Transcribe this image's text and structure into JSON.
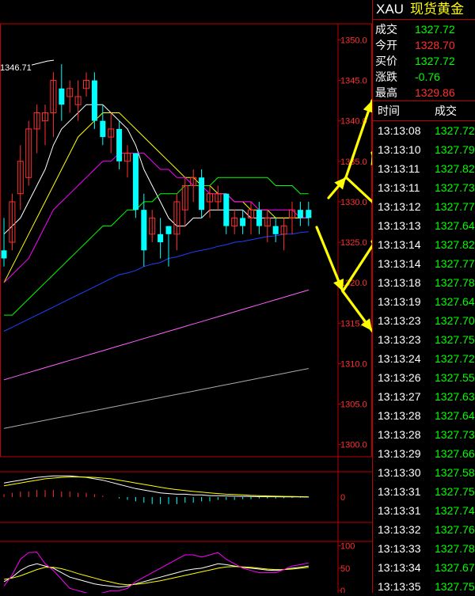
{
  "header": {
    "symbol": "XAU",
    "name": "现货黄金"
  },
  "quote": [
    {
      "label": "成交",
      "value": "1327.72",
      "color": "green"
    },
    {
      "label": "今开",
      "value": "1328.70",
      "color": "red"
    },
    {
      "label": "买价",
      "value": "1327.72",
      "color": "green"
    },
    {
      "label": "涨跌",
      "value": "-0.76",
      "color": "green"
    },
    {
      "label": "最高",
      "value": "1329.86",
      "color": "red"
    }
  ],
  "ticks_header": {
    "time": "时间",
    "price": "成交"
  },
  "ticks": [
    {
      "time": "13:13:08",
      "price": "1327.72"
    },
    {
      "time": "13:13:10",
      "price": "1327.79"
    },
    {
      "time": "13:13:11",
      "price": "1327.82"
    },
    {
      "time": "13:13:11",
      "price": "1327.73"
    },
    {
      "time": "13:13:12",
      "price": "1327.77"
    },
    {
      "time": "13:13:13",
      "price": "1327.64"
    },
    {
      "time": "13:13:14",
      "price": "1327.82"
    },
    {
      "time": "13:13:14",
      "price": "1327.77"
    },
    {
      "time": "13:13:18",
      "price": "1327.78"
    },
    {
      "time": "13:13:19",
      "price": "1327.64"
    },
    {
      "time": "13:13:23",
      "price": "1327.70"
    },
    {
      "time": "13:13:23",
      "price": "1327.75"
    },
    {
      "time": "13:13:24",
      "price": "1327.72"
    },
    {
      "time": "13:13:26",
      "price": "1327.55"
    },
    {
      "time": "13:13:27",
      "price": "1327.63"
    },
    {
      "time": "13:13:28",
      "price": "1327.64"
    },
    {
      "time": "13:13:28",
      "price": "1327.73"
    },
    {
      "time": "13:13:29",
      "price": "1327.66"
    },
    {
      "time": "13:13:30",
      "price": "1327.58"
    },
    {
      "time": "13:13:31",
      "price": "1327.75"
    },
    {
      "time": "13:13:31",
      "price": "1327.74"
    },
    {
      "time": "13:13:32",
      "price": "1327.76"
    },
    {
      "time": "13:13:33",
      "price": "1327.78"
    },
    {
      "time": "13:13:34",
      "price": "1327.67"
    },
    {
      "time": "13:13:35",
      "price": "1327.75"
    }
  ],
  "colors": {
    "up": "#ff3030",
    "down": "#00ffff",
    "grid": "#c00000",
    "arrow": "#ffff00"
  },
  "chart_data": {
    "type": "candlestick",
    "y_ticks": [
      "1350.0",
      "1345.0",
      "1340.0",
      "1335.0",
      "1330.0",
      "1325.0",
      "1320.0",
      "1315.0",
      "1310.0",
      "1305.0",
      "1300.0"
    ],
    "ylim": [
      1298.5,
      1352.0
    ],
    "annotation": "1346.71",
    "annotation_value": 1346.71,
    "candles": [
      [
        1324,
        1328,
        1322,
        1323
      ],
      [
        1325,
        1331,
        1324,
        1330
      ],
      [
        1331,
        1337,
        1329,
        1335
      ],
      [
        1333,
        1340,
        1332,
        1339
      ],
      [
        1339,
        1342,
        1336,
        1341
      ],
      [
        1340,
        1342,
        1337,
        1341
      ],
      [
        1341,
        1346,
        1338,
        1345
      ],
      [
        1344,
        1347,
        1340,
        1342
      ],
      [
        1343,
        1345,
        1341,
        1344
      ],
      [
        1342,
        1345,
        1340,
        1343
      ],
      [
        1344,
        1346,
        1343,
        1345
      ],
      [
        1345,
        1346,
        1339,
        1340
      ],
      [
        1340,
        1342,
        1337,
        1338
      ],
      [
        1338,
        1341,
        1336,
        1339
      ],
      [
        1339,
        1340,
        1334,
        1335
      ],
      [
        1335,
        1337,
        1333,
        1336
      ],
      [
        1336,
        1336,
        1328,
        1329
      ],
      [
        1329,
        1331,
        1322,
        1324
      ],
      [
        1326,
        1329,
        1325,
        1328
      ],
      [
        1326,
        1328,
        1323,
        1325
      ],
      [
        1327,
        1327,
        1322,
        1326
      ],
      [
        1326,
        1331,
        1324,
        1330
      ],
      [
        1329,
        1333,
        1327,
        1332
      ],
      [
        1332,
        1334,
        1330,
        1333
      ],
      [
        1333,
        1334,
        1328,
        1329
      ],
      [
        1330,
        1332,
        1328,
        1331
      ],
      [
        1330,
        1332,
        1329,
        1331
      ],
      [
        1331,
        1331,
        1326,
        1327
      ],
      [
        1327,
        1329,
        1326,
        1328
      ],
      [
        1328,
        1329,
        1326,
        1327
      ],
      [
        1328,
        1330,
        1326,
        1329
      ],
      [
        1329,
        1330,
        1326,
        1327
      ],
      [
        1327,
        1329,
        1325,
        1328
      ],
      [
        1327,
        1328,
        1325,
        1326
      ],
      [
        1326,
        1328,
        1324,
        1327
      ],
      [
        1328,
        1330,
        1326,
        1329
      ],
      [
        1329,
        1330,
        1327,
        1328
      ],
      [
        1329,
        1330,
        1327,
        1328
      ]
    ],
    "ma_series": [
      {
        "color": "#ffffff",
        "values": [
          1326,
          1327,
          1328,
          1330,
          1332,
          1334,
          1337,
          1339,
          1340,
          1341,
          1342,
          1342,
          1342,
          1341,
          1340,
          1339,
          1337,
          1334,
          1332,
          1330,
          1328,
          1327,
          1327,
          1328,
          1328,
          1329,
          1329,
          1329,
          1329,
          1329,
          1328,
          1328,
          1328,
          1328,
          1328,
          1328,
          1328,
          1328
        ]
      },
      {
        "color": "#ffff00",
        "values": [
          1320,
          1322,
          1324,
          1326,
          1328,
          1330,
          1332,
          1334,
          1336,
          1338,
          1339,
          1340,
          1341,
          1341,
          1341,
          1340,
          1339,
          1338,
          1337,
          1336,
          1335,
          1334,
          1333,
          1333,
          1332,
          1332,
          1331,
          1331,
          1330,
          1330,
          1329,
          1329,
          1329,
          1328,
          1328,
          1328,
          1328,
          1328
        ]
      },
      {
        "color": "#ff00ff",
        "values": [
          1320,
          1321,
          1322,
          1323,
          1325,
          1327,
          1329,
          1330,
          1331,
          1332,
          1333,
          1334,
          1335,
          1335,
          1336,
          1336,
          1336,
          1336,
          1335,
          1334,
          1334,
          1333,
          1333,
          1332,
          1332,
          1331,
          1331,
          1331,
          1330,
          1330,
          1330,
          1329,
          1329,
          1329,
          1329,
          1329,
          1328,
          1328
        ]
      },
      {
        "color": "#00ff00",
        "values": [
          1316,
          1316,
          1317,
          1318,
          1319,
          1320,
          1321,
          1322,
          1323,
          1324,
          1325,
          1326,
          1327,
          1327,
          1328,
          1329,
          1329,
          1330,
          1330,
          1331,
          1331,
          1331,
          1332,
          1332,
          1332,
          1332,
          1333,
          1333,
          1333,
          1333,
          1333,
          1333,
          1333,
          1332,
          1332,
          1332,
          1331,
          1331
        ]
      },
      {
        "color": "#2040ff",
        "values": [
          1314,
          1314.5,
          1315,
          1315.5,
          1316,
          1316.5,
          1317,
          1317.5,
          1318,
          1318.5,
          1319,
          1319.5,
          1320,
          1320.5,
          1321,
          1321.2,
          1321.5,
          1322,
          1322.3,
          1322.5,
          1323,
          1323.2,
          1323.5,
          1323.8,
          1324,
          1324.2,
          1324.5,
          1324.7,
          1325,
          1325.1,
          1325.3,
          1325.5,
          1325.7,
          1325.8,
          1326,
          1326,
          1326.2,
          1326.3
        ]
      },
      {
        "color": "#ff60ff",
        "values": [
          1308,
          1308.3,
          1308.6,
          1308.9,
          1309.2,
          1309.5,
          1309.8,
          1310.1,
          1310.4,
          1310.7,
          1311,
          1311.3,
          1311.6,
          1311.9,
          1312.2,
          1312.5,
          1312.8,
          1313.1,
          1313.4,
          1313.7,
          1314,
          1314.3,
          1314.6,
          1314.9,
          1315.2,
          1315.5,
          1315.8,
          1316.1,
          1316.4,
          1316.7,
          1317,
          1317.3,
          1317.6,
          1317.9,
          1318.2,
          1318.5,
          1318.8,
          1319.1
        ]
      },
      {
        "color": "#aaaaaa",
        "values": [
          1302,
          1302.2,
          1302.4,
          1302.6,
          1302.8,
          1303,
          1303.2,
          1303.4,
          1303.6,
          1303.8,
          1304,
          1304.2,
          1304.4,
          1304.6,
          1304.8,
          1305,
          1305.2,
          1305.4,
          1305.6,
          1305.8,
          1306,
          1306.2,
          1306.4,
          1306.6,
          1306.8,
          1307,
          1307.2,
          1307.4,
          1307.6,
          1307.8,
          1308,
          1308.2,
          1308.4,
          1308.6,
          1308.8,
          1309,
          1309.2,
          1309.4
        ]
      }
    ],
    "macd": {
      "zero_label": "0",
      "hist": [
        2,
        3,
        4,
        4,
        5,
        5,
        5,
        4,
        4,
        3,
        3,
        2,
        1,
        0,
        -1,
        -2,
        -3,
        -4,
        -5,
        -5,
        -5,
        -5,
        -4,
        -4,
        -3,
        -3,
        -2,
        -2,
        -2,
        -1.5,
        -1.5,
        -1,
        -1,
        -1,
        -0.8,
        -0.6,
        -0.5,
        -0.3
      ],
      "dif": [
        10,
        11,
        12,
        13,
        14,
        14.5,
        15,
        15,
        15,
        14.5,
        14,
        13,
        12,
        10.5,
        9,
        7.5,
        6,
        5,
        4,
        3,
        2.5,
        2,
        2,
        1.5,
        1.5,
        1,
        1,
        0.8,
        0.6,
        0.5,
        0.4,
        0.3,
        0.2,
        0.2,
        0.1,
        0.1,
        0.1,
        0
      ],
      "dea": [
        8,
        9,
        10,
        11,
        12,
        13,
        13.5,
        14,
        14.3,
        14.3,
        14.2,
        14,
        13.5,
        13,
        12,
        11,
        10,
        9,
        8,
        7,
        6,
        5.3,
        4.6,
        4,
        3.5,
        3,
        2.5,
        2,
        1.8,
        1.5,
        1.2,
        1,
        0.8,
        0.6,
        0.5,
        0.4,
        0.3,
        0.2
      ],
      "ylim": [
        -18,
        18
      ]
    },
    "kdj": {
      "y_ticks": [
        "100",
        "50",
        "0"
      ],
      "ylim": [
        -5,
        110
      ],
      "k": [
        20,
        30,
        45,
        55,
        60,
        55,
        50,
        40,
        30,
        25,
        20,
        15,
        12,
        10,
        8,
        10,
        15,
        20,
        25,
        30,
        35,
        40,
        45,
        48,
        50,
        55,
        60,
        58,
        55,
        52,
        50,
        48,
        46,
        45,
        47,
        50,
        52,
        55
      ],
      "d": [
        25,
        28,
        33,
        40,
        47,
        52,
        52,
        49,
        44,
        38,
        33,
        28,
        23,
        19,
        15,
        13,
        14,
        16,
        19,
        22,
        26,
        30,
        34,
        38,
        42,
        46,
        50,
        53,
        54,
        53,
        52,
        50,
        48,
        47,
        47,
        48,
        50,
        52
      ],
      "j": [
        10,
        35,
        70,
        85,
        86,
        60,
        45,
        25,
        5,
        0,
        -5,
        -10,
        -5,
        0,
        0,
        5,
        20,
        30,
        40,
        50,
        60,
        70,
        80,
        80,
        75,
        80,
        85,
        70,
        60,
        50,
        45,
        40,
        40,
        40,
        47,
        55,
        58,
        62
      ]
    }
  }
}
